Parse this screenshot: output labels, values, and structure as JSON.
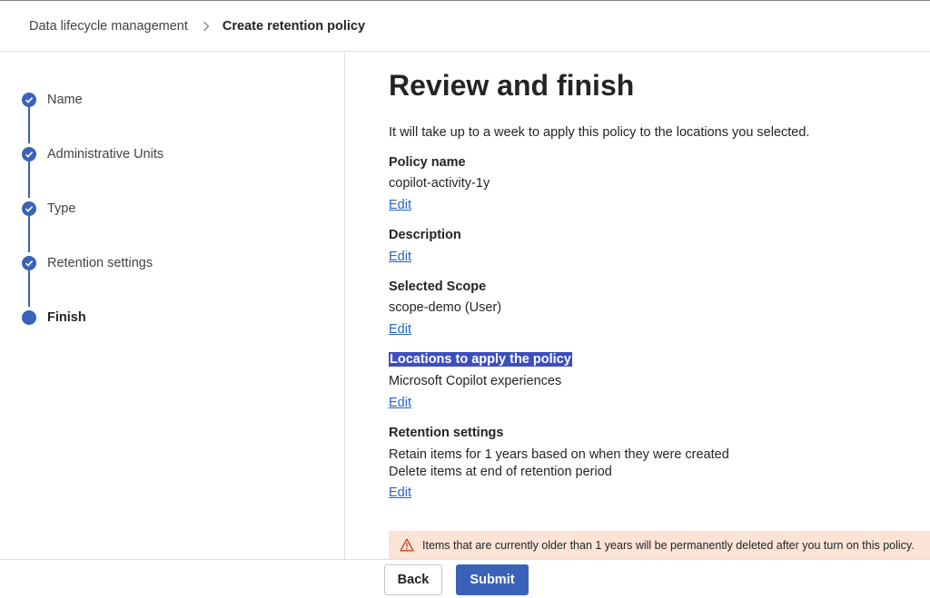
{
  "breadcrumb": {
    "parent": "Data lifecycle management",
    "current": "Create retention policy"
  },
  "wizard": {
    "steps": [
      {
        "label": "Name",
        "state": "completed"
      },
      {
        "label": "Administrative Units",
        "state": "completed"
      },
      {
        "label": "Type",
        "state": "completed"
      },
      {
        "label": "Retention settings",
        "state": "completed"
      },
      {
        "label": "Finish",
        "state": "current"
      }
    ]
  },
  "review": {
    "title": "Review and finish",
    "intro": "It will take up to a week to apply this policy to the locations you selected.",
    "edit_label": "Edit",
    "policy_name": {
      "label": "Policy name",
      "value": "copilot-activity-1y"
    },
    "description": {
      "label": "Description"
    },
    "scope": {
      "label": "Selected Scope",
      "value": "scope-demo (User)"
    },
    "locations": {
      "label": "Locations to apply the policy",
      "value": "Microsoft Copilot experiences"
    },
    "retention": {
      "label": "Retention settings",
      "line1": "Retain items for 1 years based on when they were created",
      "line2": "Delete items at end of retention period"
    }
  },
  "warning": {
    "text": "Items that are currently older than 1 years will be permanently deleted after you turn on this policy.",
    "color": "#fbe3d6"
  },
  "footer": {
    "back_label": "Back",
    "submit_label": "Submit"
  },
  "colors": {
    "accent": "#3a62b8",
    "link": "#2563c4",
    "selection": "#3c4fbf"
  }
}
